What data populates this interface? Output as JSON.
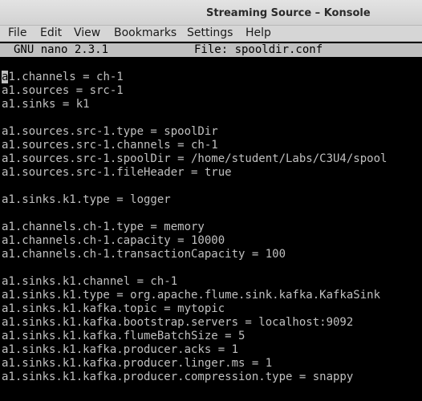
{
  "window": {
    "title": "Streaming Source – Konsole"
  },
  "menubar": {
    "items": [
      "File",
      "Edit",
      "View",
      "Bookmarks",
      "Settings",
      "Help"
    ]
  },
  "nano": {
    "version": "GNU nano 2.3.1",
    "file_label": "File: spooldir.conf"
  },
  "editor": {
    "cursor_char": "a",
    "lines": [
      "1.channels = ch-1",
      "a1.sources = src-1",
      "a1.sinks = k1",
      "",
      "a1.sources.src-1.type = spoolDir",
      "a1.sources.src-1.channels = ch-1",
      "a1.sources.src-1.spoolDir = /home/student/Labs/C3U4/spool",
      "a1.sources.src-1.fileHeader = true",
      "",
      "a1.sinks.k1.type = logger",
      "",
      "a1.channels.ch-1.type = memory",
      "a1.channels.ch-1.capacity = 10000",
      "a1.channels.ch-1.transactionCapacity = 100",
      "",
      "a1.sinks.k1.channel = ch-1",
      "a1.sinks.k1.type = org.apache.flume.sink.kafka.KafkaSink",
      "a1.sinks.k1.kafka.topic = mytopic",
      "a1.sinks.k1.kafka.bootstrap.servers = localhost:9092",
      "a1.sinks.k1.kafka.flumeBatchSize = 5",
      "a1.sinks.k1.kafka.producer.acks = 1",
      "a1.sinks.k1.kafka.producer.linger.ms = 1",
      "a1.sinks.k1.kafka.producer.compression.type = snappy"
    ]
  }
}
